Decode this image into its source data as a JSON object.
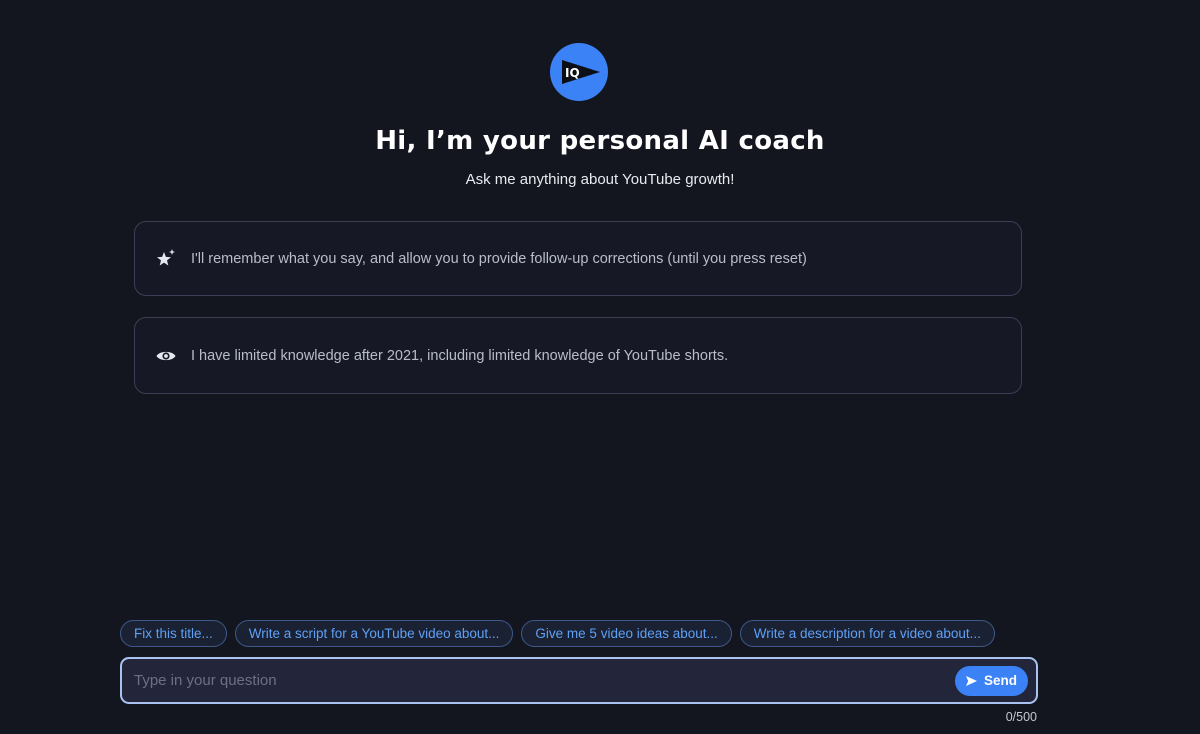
{
  "header": {
    "logo_text": "IQ",
    "title": "Hi, I’m your personal AI coach",
    "subtitle": "Ask me anything about YouTube growth!"
  },
  "info_cards": [
    {
      "icon": "sparkle-star-icon",
      "text": "I'll remember what you say, and allow you to provide follow-up corrections (until you press reset)"
    },
    {
      "icon": "eye-icon",
      "text": "I have limited knowledge after 2021, including limited knowledge of YouTube shorts."
    }
  ],
  "suggestions": [
    {
      "label": "Fix this title..."
    },
    {
      "label": "Write a script for a YouTube video about..."
    },
    {
      "label": "Give me 5 video ideas about..."
    },
    {
      "label": "Write a description for a video about..."
    }
  ],
  "composer": {
    "placeholder": "Type in your question",
    "value": "",
    "send_label": "Send",
    "send_icon": "send-arrow-icon",
    "char_count": "0/500"
  },
  "colors": {
    "background": "#13151f",
    "accent": "#3b82f6",
    "chip_text": "#5fa0f5",
    "input_border": "#a9c3f0"
  }
}
